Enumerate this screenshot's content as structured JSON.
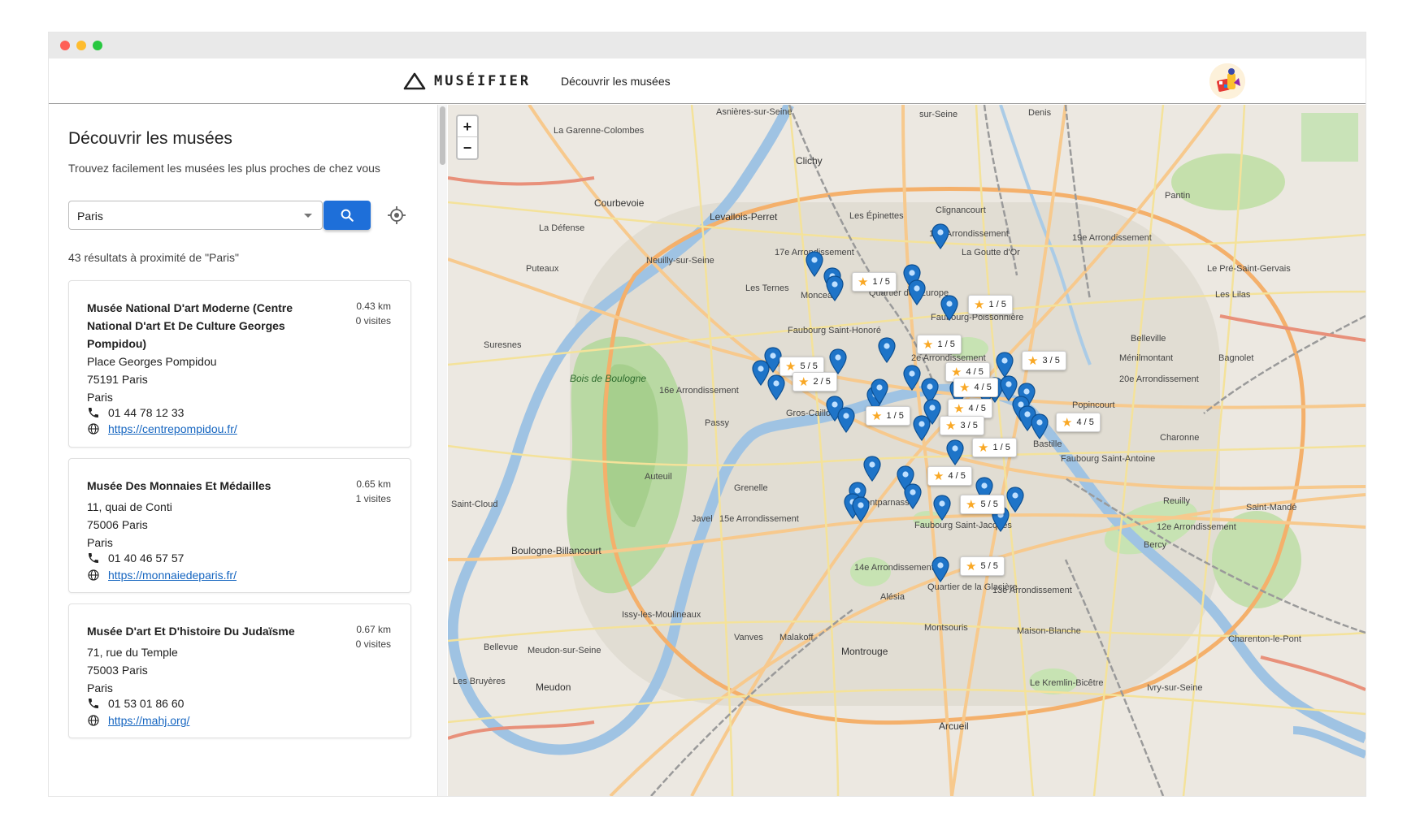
{
  "app": {
    "logo_text": "MUSÉIFIER",
    "nav_link": "Découvrir les musées"
  },
  "sidebar": {
    "title": "Découvrir les musées",
    "subtitle": "Trouvez facilement les musées les plus proches de chez vous",
    "search_value": "Paris",
    "results_count": "43 résultats à proximité de \"Paris\""
  },
  "museums": [
    {
      "name": "Musée National D'art Moderne (Centre National D'art Et De Culture Georges Pompidou)",
      "distance": "0.43 km",
      "visits": "0 visites",
      "address1": "Place Georges Pompidou",
      "address2": "75191 Paris",
      "city": "Paris",
      "phone": "01 44 78 12 33",
      "url": "https://centrepompidou.fr/"
    },
    {
      "name": "Musée Des Monnaies Et Médailles",
      "distance": "0.65 km",
      "visits": "1 visites",
      "address1": "11, quai de Conti",
      "address2": "75006 Paris",
      "city": "Paris",
      "phone": "01 40 46 57 57",
      "url": "https://monnaiedeparis.fr/"
    },
    {
      "name": "Musée D'art Et D'histoire Du Judaïsme",
      "distance": "0.67 km",
      "visits": "0 visites",
      "address1": "71, rue du Temple",
      "address2": "75003 Paris",
      "city": "Paris",
      "phone": "01 53 01 86 60",
      "url": "https://mahj.org/"
    }
  ],
  "map": {
    "zoom_in": "+",
    "zoom_out": "−",
    "ratings": [
      "1 / 5",
      "1 / 5",
      "1 / 5",
      "3 / 5",
      "5 / 5",
      "2 / 5",
      "4 / 5",
      "4 / 5",
      "4 / 5",
      "1 / 5",
      "3 / 5",
      "4 / 5",
      "1 / 5",
      "4 / 5",
      "5 / 5",
      "5 / 5"
    ],
    "labels": {
      "asnieres": "Asnières-sur-Seine",
      "garenne": "La Garenne-Colombes",
      "clichy": "Clichy",
      "courbevoie": "Courbevoie",
      "levallois": "Levallois-Perret",
      "epinettes": "Les Épinettes",
      "clignancourt": "Clignancourt",
      "arr18": "18e Arrondissement",
      "goutte": "La Goutte d'Or",
      "arr19": "19e Arrondissement",
      "pantin": "Pantin",
      "defense": "La Défense",
      "puteaux": "Puteaux",
      "neuilly": "Neuilly-sur-Seine",
      "arr17": "17e Arrondissement",
      "monceau": "Monceau",
      "ternes": "Les Ternes",
      "europe": "Quartier de l'Europe",
      "faubourg_poiss": "Faubourg-Poissonnière",
      "pre_st_gervais": "Le Pré-Saint-Gervais",
      "lilas": "Les Lilas",
      "suresnes": "Suresnes",
      "fb_st_honore": "Faubourg Saint-Honoré",
      "belleville": "Belleville",
      "bagnolet": "Bagnolet",
      "bois": "Bois de Boulogne",
      "arr16": "16e Arrondissement",
      "arr2": "2e Arrondissement",
      "menilmontant": "Ménilmontant",
      "arr20": "20e Arrondissement",
      "gros_caillou": "Gros-Caillou",
      "passy": "Passy",
      "popincourt": "Popincourt",
      "charonne": "Charonne",
      "bastille": "Bastille",
      "fb_st_antoine": "Faubourg Saint-Antoine",
      "st_cloud": "Saint-Cloud",
      "auteuil": "Auteuil",
      "grenelle": "Grenelle",
      "javel": "Javel",
      "arr15": "15e Arrondissement",
      "montparnasse": "Montparnasse",
      "fb_st_jacques": "Faubourg Saint-Jacques",
      "reuilly": "Reuilly",
      "st_mande": "Saint-Mandé",
      "arr12": "12e Arrondissement",
      "bercy": "Bercy",
      "boulogne": "Boulogne-Billancourt",
      "arr14": "14e Arrondissement",
      "glaciere": "Quartier de la Glacière",
      "arr13": "13e Arrondissement",
      "alesia": "Alésia",
      "issy": "Issy-les-Moulineaux",
      "vanves": "Vanves",
      "malakoff": "Malakoff",
      "montsouris": "Montsouris",
      "maison_blanche": "Maison-Blanche",
      "charenton": "Charenton-le-Pont",
      "montrouge": "Montrouge",
      "bellevue": "Bellevue",
      "meudon_seine": "Meudon-sur-Seine",
      "bruyeres": "Les Bruyères",
      "meudon": "Meudon",
      "kremlin": "Le Kremlin-Bicêtre",
      "ivry": "Ivry-sur-Seine",
      "arcueil": "Arcueil",
      "denis": "Denis",
      "ouen": "sur-Seine"
    }
  }
}
